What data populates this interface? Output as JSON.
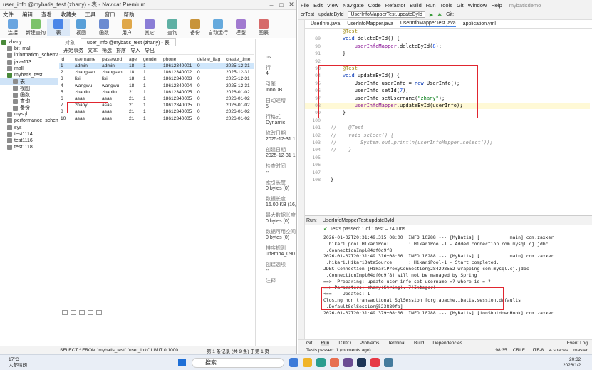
{
  "navicat": {
    "title": "user_info @mybatis_test (zhany) - 表 - Navicat Premium",
    "menu": [
      "文件",
      "编辑",
      "查看",
      "收藏夹",
      "工具",
      "窗口",
      "帮助"
    ],
    "toolbar": [
      "连接",
      "新建查询",
      "表",
      "视图",
      "函数",
      "用户",
      "其它",
      "查询",
      "备份",
      "自动运行",
      "模型",
      "图表"
    ],
    "tree": [
      {
        "label": "zhany",
        "level": 0,
        "open": true
      },
      {
        "label": "bit_mall",
        "level": 1
      },
      {
        "label": "information_schema",
        "level": 1
      },
      {
        "label": "java113",
        "level": 1
      },
      {
        "label": "mall",
        "level": 1
      },
      {
        "label": "mybatis_test",
        "level": 1,
        "open": true
      },
      {
        "label": "表",
        "level": 2,
        "selected": true
      },
      {
        "label": "视图",
        "level": 2
      },
      {
        "label": "函数",
        "level": 2
      },
      {
        "label": "查询",
        "level": 2
      },
      {
        "label": "备份",
        "level": 2
      },
      {
        "label": "mysql",
        "level": 1
      },
      {
        "label": "performance_schema",
        "level": 1
      },
      {
        "label": "sys",
        "level": 1
      },
      {
        "label": "test1114",
        "level": 1
      },
      {
        "label": "test1116",
        "level": 1
      },
      {
        "label": "test1118",
        "level": 1
      }
    ],
    "tabs": [
      "对象",
      "user_info @mybatis_test (zhany) - 表"
    ],
    "table_toolbar": [
      "开始事务",
      "文本",
      "筛选",
      "排序",
      "导入",
      "导出"
    ],
    "columns": [
      "id",
      "username",
      "password",
      "age",
      "gender",
      "phone",
      "delete_flag",
      "create_time"
    ],
    "rows": [
      [
        "1",
        "admin",
        "admin",
        "18",
        "1",
        "18612340001",
        "0",
        "2025-12-31"
      ],
      [
        "2",
        "zhangsan",
        "zhangsan",
        "18",
        "1",
        "18612340002",
        "0",
        "2025-12-31"
      ],
      [
        "3",
        "lisi",
        "lisi",
        "18",
        "1",
        "18612340003",
        "0",
        "2025-12-31"
      ],
      [
        "4",
        "wangwu",
        "wangwu",
        "18",
        "1",
        "18612340004",
        "0",
        "2025-12-31"
      ],
      [
        "5",
        "zhaoliu",
        "zhaoliu",
        "21",
        "1",
        "18612340005",
        "0",
        "2026-01-02"
      ],
      [
        "6",
        "asas",
        "asas",
        "21",
        "1",
        "18612340005",
        "0",
        "2026-01-02"
      ],
      [
        "7",
        "zhany",
        "asas",
        "21",
        "1",
        "18612340005",
        "0",
        "2026-01-02"
      ],
      [
        "8",
        "asas",
        "asas",
        "21",
        "1",
        "18612340005",
        "0",
        "2026-01-02"
      ],
      [
        "10",
        "asas",
        "asas",
        "21",
        "1",
        "18612340005",
        "0",
        "2026-01-02"
      ]
    ],
    "info_panel": {
      "header": "us",
      "items": [
        {
          "label": "行",
          "value": "4"
        },
        {
          "label": "引擎",
          "value": "InnoDB"
        },
        {
          "label": "自动递增",
          "value": "5"
        },
        {
          "label": "行格式",
          "value": "Dynamic"
        },
        {
          "label": "修改日期",
          "value": "2025-12-31 1"
        },
        {
          "label": "创建日期",
          "value": "2025-12-31 1"
        },
        {
          "label": "检查时间",
          "value": "--"
        },
        {
          "label": "索引长度",
          "value": "0 bytes (0)"
        },
        {
          "label": "数据长度",
          "value": "16.00 KB (16,"
        },
        {
          "label": "最大数据长度",
          "value": "0 bytes (0)"
        },
        {
          "label": "数据可用空间",
          "value": "0 bytes (0)"
        },
        {
          "label": "排序规则",
          "value": "utf8mb4_090"
        },
        {
          "label": "创建选项",
          "value": "--"
        },
        {
          "label": "注释",
          "value": ""
        }
      ]
    },
    "status": {
      "query": "SELECT * FROM `mybatis_test`.`user_info` LIMIT 0,1000",
      "record": "第 1 条记录 (共 9 条) 于第 1 页"
    }
  },
  "ide": {
    "menu": [
      "File",
      "Edit",
      "View",
      "Navigate",
      "Code",
      "Refactor",
      "Build",
      "Run",
      "Tools",
      "Git",
      "Window",
      "Help"
    ],
    "project_name": "mybatisdemo",
    "nav": {
      "crumb1": "erTest",
      "crumb2": "updateById",
      "run_config": "UserInfoMapperTest.updateById",
      "git": "Git:"
    },
    "file_tabs": [
      "UserInfo.java",
      "UserInfoMapper.java",
      "UserInfoMapperTest.java",
      "application.yml"
    ],
    "active_tab": 2,
    "code_lines": [
      {
        "n": "",
        "text": "    @Test"
      },
      {
        "n": "89",
        "text": "    void deleteById() {"
      },
      {
        "n": "90",
        "text": "        userInfoMapper.deleteById(8);"
      },
      {
        "n": "91",
        "text": "    }"
      },
      {
        "n": "92",
        "text": ""
      },
      {
        "n": "93",
        "text": "    @Test"
      },
      {
        "n": "94",
        "text": "    void updateById() {"
      },
      {
        "n": "95",
        "text": "        UserInfo userInfo = new UserInfo();"
      },
      {
        "n": "96",
        "text": "        userInfo.setId(7);"
      },
      {
        "n": "97",
        "text": "        userInfo.setUsername(\"zhany\");"
      },
      {
        "n": "98",
        "text": "        userInfoMapper.updateById(userInfo);"
      },
      {
        "n": "99",
        "text": "    }"
      },
      {
        "n": "100",
        "text": ""
      },
      {
        "n": "101",
        "text": "//    @Test"
      },
      {
        "n": "102",
        "text": "//    void select() {"
      },
      {
        "n": "103",
        "text": "//        System.out.println(userInfoMapper.select());"
      },
      {
        "n": "104",
        "text": "//    }"
      },
      {
        "n": "105",
        "text": ""
      },
      {
        "n": "106",
        "text": ""
      },
      {
        "n": "107",
        "text": ""
      },
      {
        "n": "108",
        "text": "}"
      }
    ],
    "run": {
      "label": "Run:",
      "tab": "UserInfoMapperTest.updateById",
      "status": "Tests passed: 1 of 1 test – 740 ms"
    },
    "console": [
      "2026-01-02T20:31:49.315+08:00  INFO 10288 --- [MyBatis] [           main] com.zaxxer",
      " .hikari.pool.HikariPool       : HikariPool-1 - Added connection com.mysql.cj.jdbc",
      " .ConnectionImpl@4df0d9f8",
      "2026-01-02T20:31:49.316+08:00  INFO 10288 --- [MyBatis] [           main] com.zaxxer",
      " .hikari.HikariDataSource      : HikariPool-1 - Start completed.",
      "JDBC Connection [HikariProxyConnection@284298552 wrapping com.mysql.cj.jdbc",
      " .ConnectionImpl@4df0d9f8] will not be managed by Spring",
      "==>  Preparing: update user_info set username =? where id = ?",
      "==> Parameters: zhany(String), 7(Integer)",
      "<==    Updates: 1",
      "Closing non transactional SqlSession [org.apache.ibatis.session.defaults",
      " .DefaultSqlSession@523889fa]",
      "2026-01-02T20:31:49.379+08:00  INFO 10288 --- [MyBatis] [ionShutdownHook] com.zaxxer"
    ],
    "bottom_tabs": [
      "Git",
      "Run",
      "TODO",
      "Problems",
      "Terminal",
      "Build",
      "Dependencies",
      "Event Log"
    ],
    "status": {
      "left": "Tests passed: 1 (moments ago)",
      "pos": "98:35",
      "eol": "CRLF",
      "enc": "UTF-8",
      "indent": "4 spaces",
      "branch": "master"
    }
  },
  "taskbar": {
    "temp": "17°C",
    "weather": "大部晴朗",
    "search": "搜索",
    "time": "20:32",
    "date": "2026/1/2"
  },
  "colors": {
    "highlight_box": "#e0262f",
    "selected_row": "#cfe6fb",
    "keyword": "#0033b3"
  }
}
